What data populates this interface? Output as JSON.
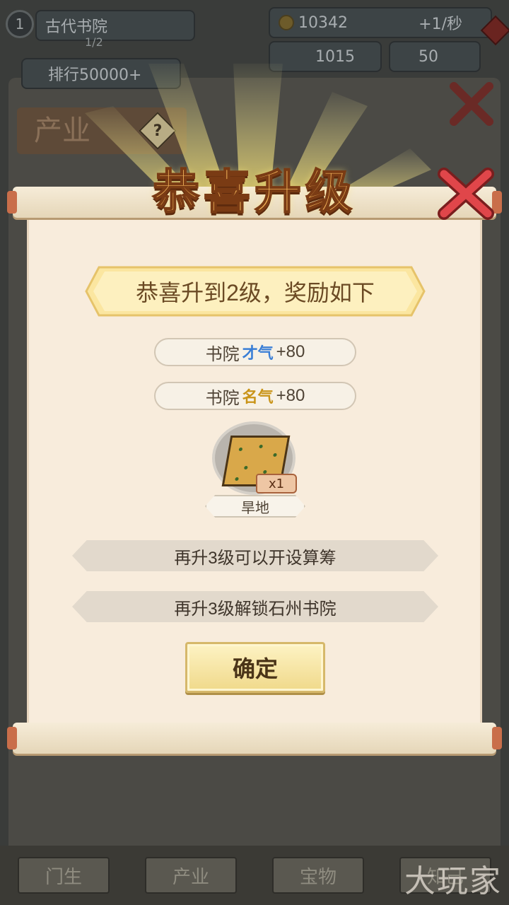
{
  "hud": {
    "level": "1",
    "academy_name": "古代书院",
    "academy_sub": "1/2",
    "rank": "排行50000+",
    "coins": "10342",
    "coin_rate": "+1/秒",
    "talent": "1015",
    "scrolls": "50"
  },
  "background": {
    "tab_label": "产业",
    "help_label": "?"
  },
  "modal": {
    "title": "恭喜升级",
    "banner": "恭喜升到2级，奖励如下",
    "rewards": [
      {
        "prefix": "书院",
        "stat": "才气",
        "amount": "+80"
      },
      {
        "prefix": "书院",
        "stat": "名气",
        "amount": "+80"
      }
    ],
    "item": {
      "name": "旱地",
      "qty": "x1"
    },
    "info": [
      "再升3级可以开设算筹",
      "再升3级解锁石州书院"
    ],
    "confirm_label": "确定"
  },
  "bottom_nav": [
    "门生",
    "产业",
    "宝物",
    "知己"
  ],
  "watermark": "大玩家",
  "colors": {
    "title": "#f3b45a",
    "paper": "#f8ecdc",
    "close": "#e0464a",
    "talent": "#3a7ed6",
    "fame": "#c99418"
  }
}
